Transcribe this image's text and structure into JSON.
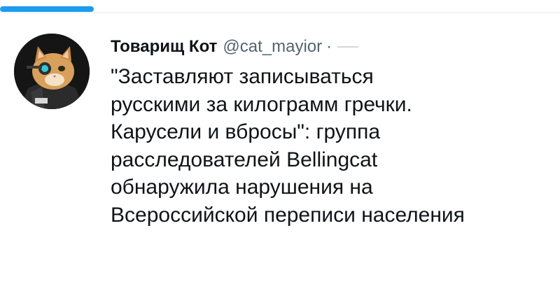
{
  "tweet": {
    "author": {
      "display_name": "Товарищ Кот",
      "handle": "@cat_mayior",
      "separator": "·",
      "avatar": "cat-with-cyborg-eyepiece-avatar"
    },
    "text": "\"Заставляют записываться\nрусскими за килограмм гречки.\nКарусели и вбросы\": группа\nрасследователей Bellingcat\nобнаружила нарушения на\nВсероссийской переписи населения"
  },
  "colors": {
    "accent": "#1d9bf0",
    "text": "#0f1419",
    "secondary_text": "#536471",
    "divider": "#e6ecf0"
  }
}
